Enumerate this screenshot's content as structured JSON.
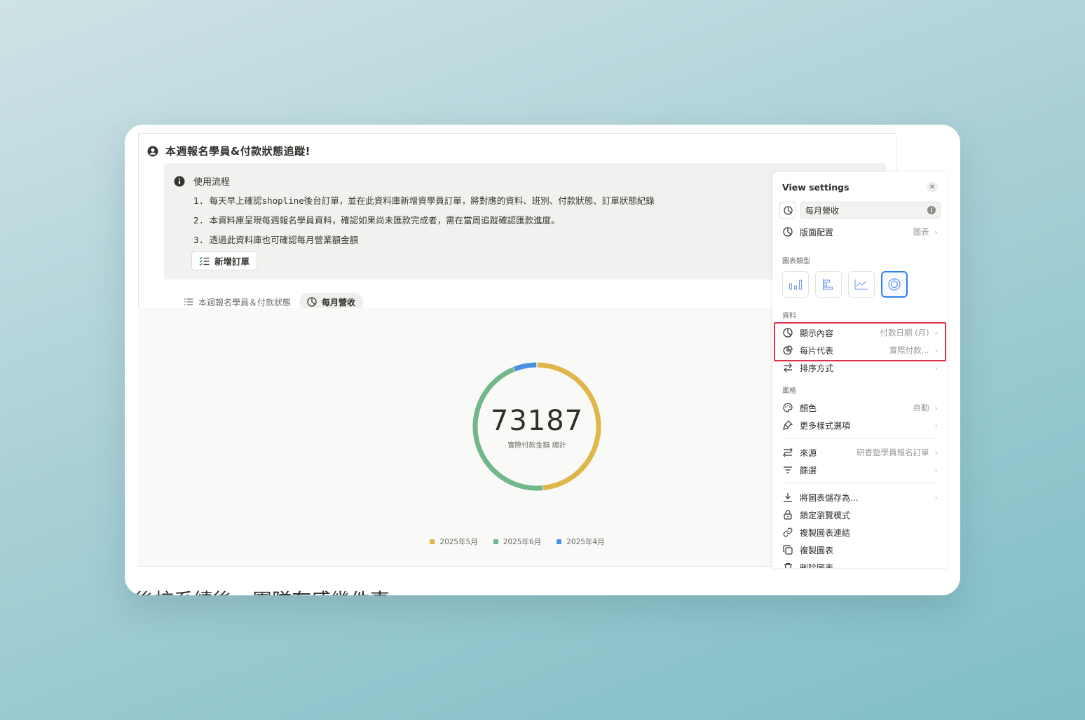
{
  "callout": {
    "title": "本週報名學員&付款狀態追蹤!",
    "info_title": "使用流程",
    "steps": [
      "1. 每天早上確認shopline後台訂單，並在此資料庫新增資學員訂單，將對應的資料、班別、付款狀態、訂單狀態紀錄",
      "2. 本資料庫呈現每週報名學員資料，確認如果尚未匯款完成者，需在當周追蹤確認匯款進度。",
      "3. 透過此資料庫也可確認每月營業額金額"
    ],
    "add_order_label": "新增訂單"
  },
  "views": {
    "table_tab": "本週報名學員＆付款狀態",
    "chart_tab": "每月營收"
  },
  "chart_data": {
    "type": "pie",
    "total": "73187",
    "total_label": "實際付款金額 總計",
    "categories": [
      "2025年5月",
      "2025年6月",
      "2025年4月"
    ],
    "values": [
      0.485,
      0.455,
      0.06
    ],
    "colors": [
      "#dfb64a",
      "#72b68b",
      "#4a90e2"
    ]
  },
  "heading_below": "後校系績後，團隊有感幾件事",
  "panel": {
    "title": "View settings",
    "view_name": "每月營收",
    "layout_label": "版面配置",
    "layout_value": "圖表",
    "chart_type_section": "圖表類型",
    "data_section": "資料",
    "show_label": "顯示內容",
    "show_value": "付款日期 (月)",
    "slice_label": "每片代表",
    "slice_value": "實際付款...",
    "sort_label": "排序方式",
    "style_section": "風格",
    "color_label": "顏色",
    "color_value": "自動",
    "more_style_label": "更多樣式選項",
    "source_label": "來源",
    "source_value": "研香塾學員報名訂單",
    "filter_label": "篩選",
    "save_label": "將圖表儲存為...",
    "lock_label": "鎖定瀏覽模式",
    "copy_link_label": "複製圖表連結",
    "duplicate_label": "複製圖表",
    "delete_label": "刪除圖表"
  }
}
